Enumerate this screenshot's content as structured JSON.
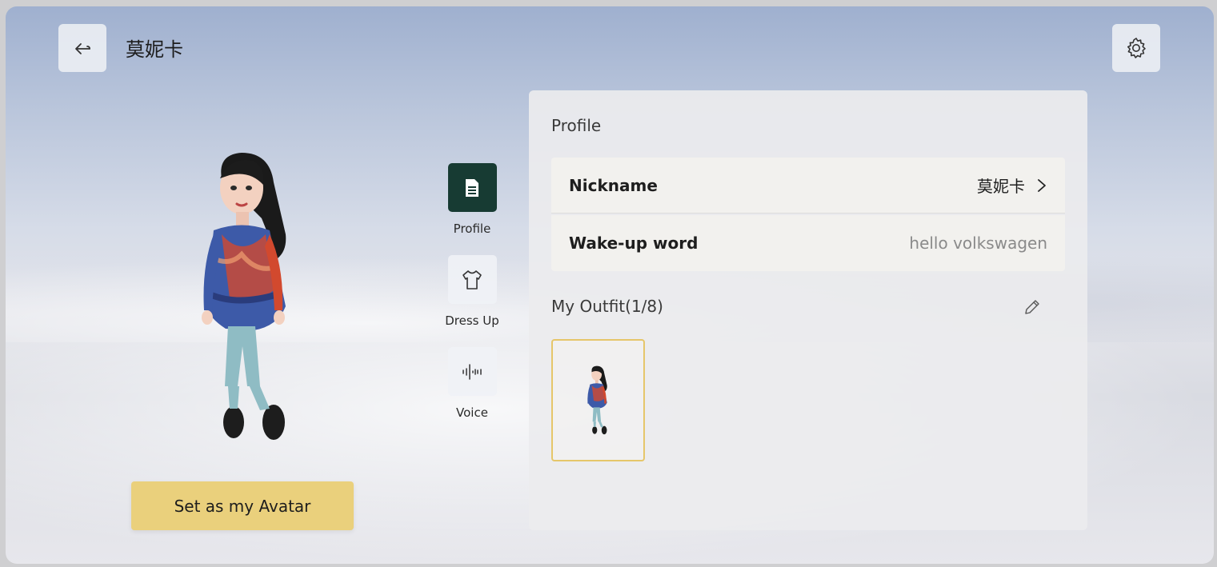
{
  "header": {
    "title": "莫妮卡",
    "back_icon": "back-arrow-icon",
    "settings_icon": "gear-icon"
  },
  "avatar": {
    "set_button_label": "Set as my Avatar"
  },
  "tabs": [
    {
      "label": "Profile",
      "icon": "document-icon",
      "active": true
    },
    {
      "label": "Dress Up",
      "icon": "shirt-icon",
      "active": false
    },
    {
      "label": "Voice",
      "icon": "waveform-icon",
      "active": false
    }
  ],
  "profile": {
    "section_title": "Profile",
    "nickname_label": "Nickname",
    "nickname_value": "莫妮卡",
    "wake_label": "Wake-up word",
    "wake_value": "hello volkswagen"
  },
  "outfit": {
    "title": "My Outfit(1/8)"
  },
  "colors": {
    "accent_yellow": "#ead07c",
    "active_tab": "#173b33",
    "outfit_border": "#e6c66a"
  }
}
